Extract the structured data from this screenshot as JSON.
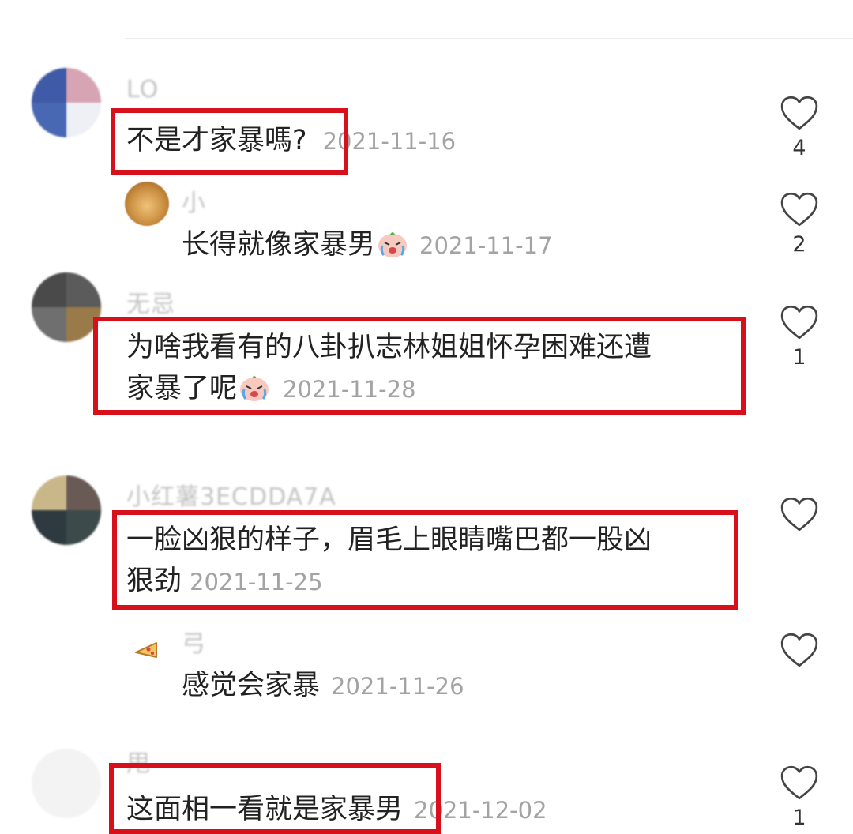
{
  "colors": {
    "highlight": "#d8101b",
    "date": "#a3a3a3",
    "text": "#222222",
    "name": "#b8b8b8"
  },
  "comments": [
    {
      "name": "LO",
      "text": "不是才家暴嗎?",
      "date": "2021-11-16",
      "likes": "4"
    },
    {
      "name": "小",
      "text": "长得就像家暴男",
      "date": "2021-11-17",
      "likes": "2",
      "emoji": "crying-face-emoji"
    },
    {
      "name": "无忌",
      "line1": "为啥我看有的八卦扒志林姐姐怀孕困难还遭",
      "line2": "家暴了呢",
      "date": "2021-11-28",
      "likes": "1",
      "emoji": "crying-face-emoji"
    },
    {
      "name": "小红薯3ECDDA7A",
      "line1": "一脸凶狠的样子，眉毛上眼睛嘴巴都一股凶",
      "line2": "狠劲",
      "date": "2021-11-25"
    },
    {
      "name": "弓",
      "text": "感觉会家暴",
      "date": "2021-11-26",
      "icon": "pizza-icon"
    },
    {
      "name": "甩",
      "text": "这面相一看就是家暴男",
      "date": "2021-12-02",
      "likes": "1"
    }
  ]
}
